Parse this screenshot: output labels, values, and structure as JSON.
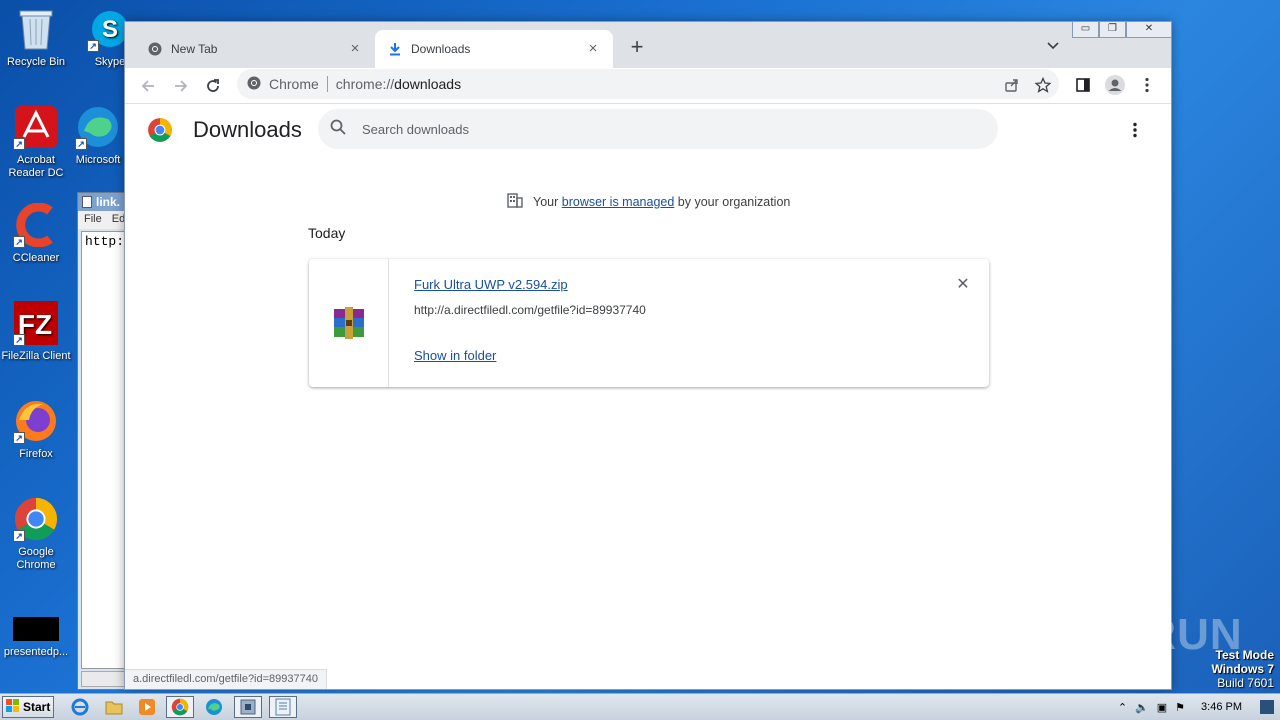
{
  "desktop": {
    "icons": [
      {
        "label": "Recycle Bin"
      },
      {
        "label": "Skype"
      },
      {
        "label": "Acrobat Reader DC"
      },
      {
        "label": "Microsoft"
      },
      {
        "label": "CCleaner"
      },
      {
        "label": "FileZilla Client"
      },
      {
        "label": "Firefox"
      },
      {
        "label": "Google Chrome"
      },
      {
        "label": "presentedp..."
      }
    ],
    "notepad": {
      "title": "link.",
      "menu_file": "File",
      "menu_edit": "Ed",
      "content": "http:"
    }
  },
  "browser": {
    "tabs": [
      {
        "title": "New Tab",
        "close": "×"
      },
      {
        "title": "Downloads",
        "close": "×"
      }
    ],
    "new_tab": "+",
    "omnibox": {
      "chip": "Chrome",
      "url_scheme": "chrome://",
      "url_host": "downloads"
    },
    "status_url": "a.directfiledl.com/getfile?id=89937740"
  },
  "downloads_page": {
    "title": "Downloads",
    "search_placeholder": "Search downloads",
    "managed_prefix": "Your",
    "managed_link": "browser is managed",
    "managed_suffix": "by your organization",
    "date_label": "Today",
    "item": {
      "filename": "Furk Ultra UWP v2.594.zip",
      "url": "http://a.directfiledl.com/getfile?id=89937740",
      "action": "Show in folder"
    }
  },
  "watermark": {
    "text": "ANY RUN"
  },
  "system": {
    "test_mode": "Test Mode",
    "os": "Windows 7",
    "build": "Build 7601",
    "start_label": "Start",
    "clock": "3:46 PM"
  },
  "colors": {
    "link": "#1a4fa0",
    "accent": "#1a73e8"
  }
}
